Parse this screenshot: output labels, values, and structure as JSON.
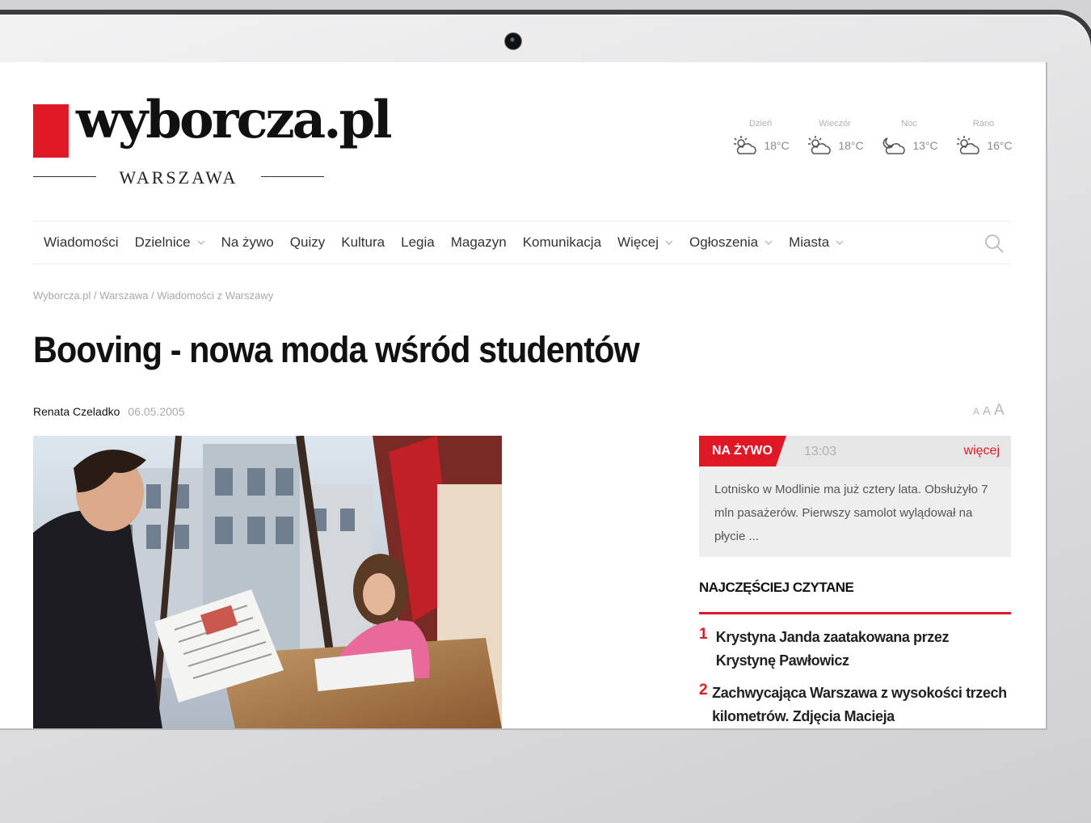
{
  "site": {
    "logo": "wyborcza.pl",
    "city": "WARSZAWA"
  },
  "weather": [
    {
      "label": "Dzień",
      "temp": "18°C",
      "icon": "partly-cloudy-icon"
    },
    {
      "label": "Wieczór",
      "temp": "18°C",
      "icon": "partly-cloudy-icon"
    },
    {
      "label": "Noc",
      "temp": "13°C",
      "icon": "night-cloudy-icon"
    },
    {
      "label": "Rano",
      "temp": "16°C",
      "icon": "partly-cloudy-icon"
    }
  ],
  "nav": {
    "items": [
      {
        "label": "Wiadomości",
        "dropdown": false
      },
      {
        "label": "Dzielnice",
        "dropdown": true
      },
      {
        "label": "Na żywo",
        "dropdown": false
      },
      {
        "label": "Quizy",
        "dropdown": false
      },
      {
        "label": "Kultura",
        "dropdown": false
      },
      {
        "label": "Legia",
        "dropdown": false
      },
      {
        "label": "Magazyn",
        "dropdown": false
      },
      {
        "label": "Komunikacja",
        "dropdown": false
      },
      {
        "label": "Więcej",
        "dropdown": true
      },
      {
        "label": "Ogłoszenia",
        "dropdown": true
      },
      {
        "label": "Miasta",
        "dropdown": true
      }
    ]
  },
  "breadcrumb": "Wyborcza.pl / Warszawa / Wiadomości z Warszawy",
  "article": {
    "title": "Booving - nowa moda wśród studentów",
    "author": "Renata Czeladko",
    "date": "06.05.2005",
    "font_controls": [
      "A",
      "A",
      "A"
    ]
  },
  "live": {
    "tag": "NA ŻYWO",
    "time": "13:03",
    "more": "więcej",
    "text": "Lotnisko w Modlinie ma już cztery lata. Obsłużyło 7 mln pasażerów. Pierwszy samolot wylądował na płycie ..."
  },
  "popular": {
    "title": "NAJCZĘŚCIEJ CZYTANE",
    "items": [
      {
        "num": "1",
        "text": "Krystyna Janda zaatakowana przez Krystynę Pawłowicz"
      },
      {
        "num": "2",
        "text": "Zachwycająca Warszawa z wysokości trzech kilometrów. Zdjęcia Macieja"
      }
    ]
  },
  "colors": {
    "accent": "#e01826"
  }
}
